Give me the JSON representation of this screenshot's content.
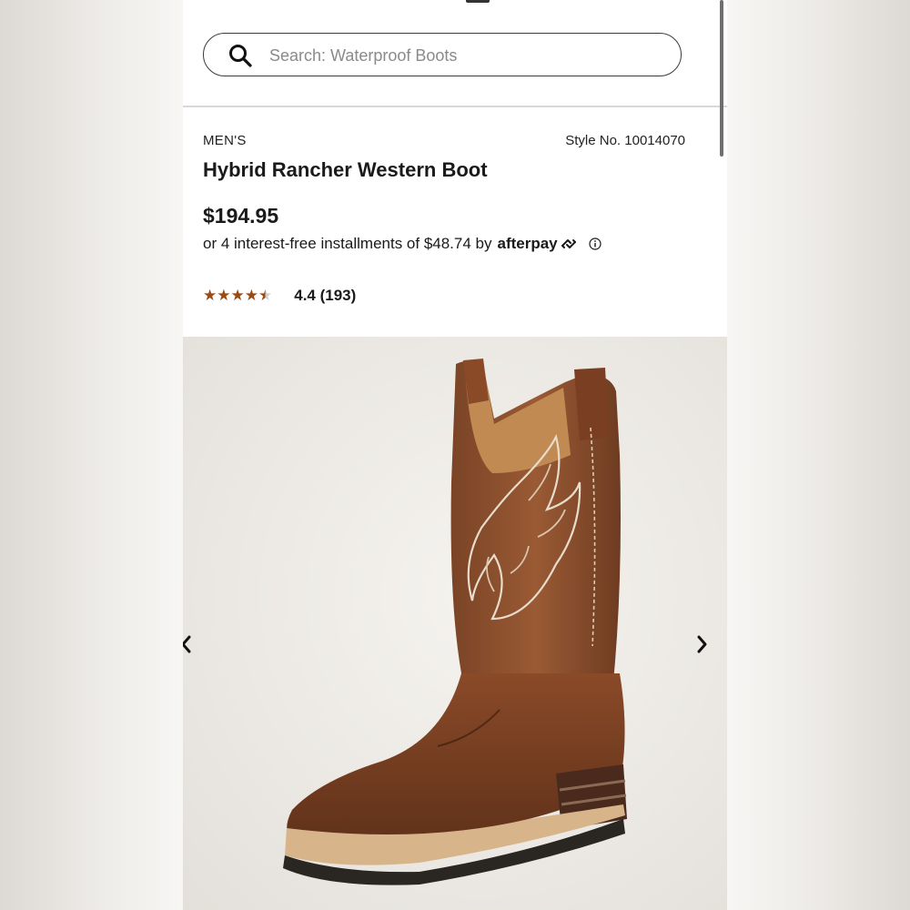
{
  "search": {
    "placeholder": "Search: Waterproof Boots"
  },
  "product": {
    "category": "MEN'S",
    "style_no": "Style No. 10014070",
    "title": "Hybrid Rancher Western Boot",
    "price": "$194.95",
    "installments_text": "or 4 interest-free installments of $48.74 by",
    "afterpay_label": "afterpay",
    "rating_text": "4.4 (193)",
    "rating_value": 4.4,
    "rating_max": 5
  },
  "icons": {
    "search": "search-icon",
    "afterpay": "afterpay-loop-icon",
    "info": "info-icon",
    "prev": "chevron-left-icon",
    "next": "chevron-right-icon",
    "star": "star-icon"
  },
  "colors": {
    "star": "#9a4a16",
    "text": "#1a1a1a",
    "image_bg": "#ebe8e3"
  }
}
